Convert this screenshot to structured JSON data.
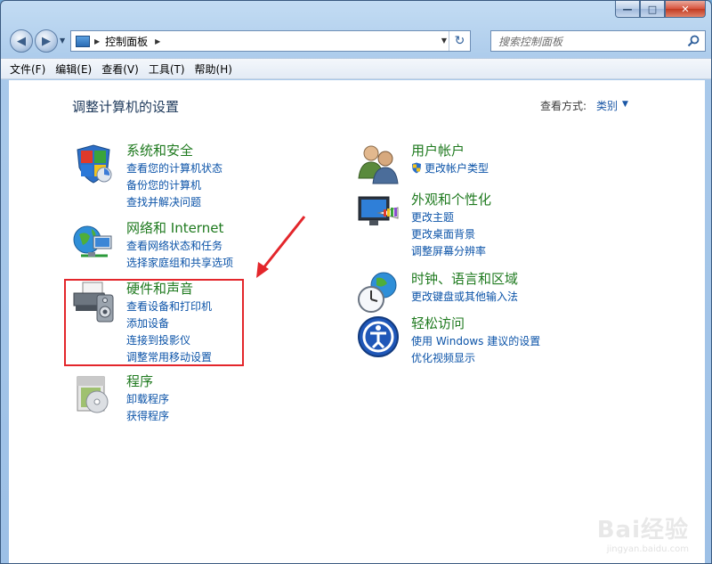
{
  "window": {
    "caption_buttons": {
      "minimize": "—",
      "maximize": "□",
      "close": "✕"
    }
  },
  "nav": {
    "back_glyph": "◀",
    "forward_glyph": "▶",
    "address": {
      "separator": "▶",
      "location": "控制面板"
    },
    "refresh_glyph": "↻",
    "search_placeholder": "搜索控制面板"
  },
  "menu": [
    "文件(F)",
    "编辑(E)",
    "查看(V)",
    "工具(T)",
    "帮助(H)"
  ],
  "content": {
    "page_title": "调整计算机的设置",
    "view_by_label": "查看方式:",
    "view_by_value": "类别",
    "categories_left": [
      {
        "title": "系统和安全",
        "icon": "security-shield-icon",
        "links": [
          "查看您的计算机状态",
          "备份您的计算机",
          "查找并解决问题"
        ]
      },
      {
        "title": "网络和 Internet",
        "icon": "network-globe-icon",
        "links": [
          "查看网络状态和任务",
          "选择家庭组和共享选项"
        ]
      },
      {
        "title": "硬件和声音",
        "icon": "printer-speaker-icon",
        "links": [
          "查看设备和打印机",
          "添加设备",
          "连接到投影仪",
          "调整常用移动设置"
        ]
      },
      {
        "title": "程序",
        "icon": "programs-disc-icon",
        "links": [
          "卸载程序",
          "获得程序"
        ]
      }
    ],
    "categories_right": [
      {
        "title": "用户帐户",
        "icon": "users-icon",
        "links": [
          "更改帐户类型"
        ]
      },
      {
        "title": "外观和个性化",
        "icon": "monitor-palette-icon",
        "links": [
          "更改主题",
          "更改桌面背景",
          "调整屏幕分辨率"
        ]
      },
      {
        "title": "时钟、语言和区域",
        "icon": "clock-globe-icon",
        "links": [
          "更改键盘或其他输入法"
        ]
      },
      {
        "title": "轻松访问",
        "icon": "accessibility-icon",
        "links": [
          "使用 Windows 建议的设置",
          "优化视频显示"
        ]
      }
    ]
  },
  "watermark": {
    "logo": "Baidu经验",
    "url": "jingyan.baidu.com"
  },
  "colors": {
    "category_title": "#1f7a1f",
    "link": "#0b53a8",
    "highlight": "#e3262b"
  }
}
